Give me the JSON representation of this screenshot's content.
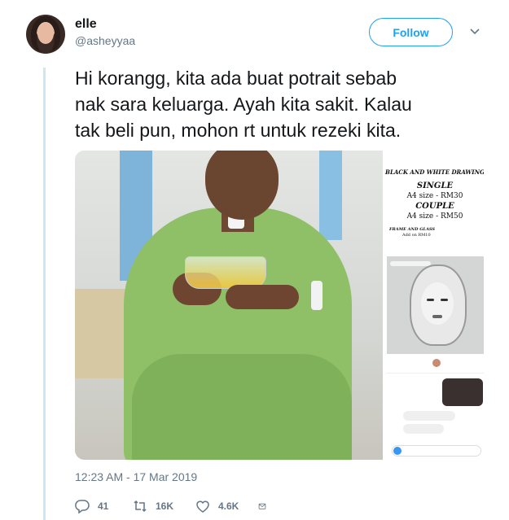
{
  "user": {
    "display_name": "elle",
    "handle": "@asheyyaa",
    "follow_label": "Follow"
  },
  "tweet": {
    "text": "Hi korangg, kita ada buat potrait sebab\nnak sara keluarga. Ayah kita sakit. Kalau\ntak beli pun, mohon rt untuk rezeki kita.",
    "timestamp": "12:23 AM - 17 Mar 2019"
  },
  "media": {
    "price_card": {
      "heading": "BLACK AND WHITE DRAWING",
      "single_label": "SINGLE",
      "single_price": "A4 size - RM30",
      "couple_label": "COUPLE",
      "couple_price": "A4 size - RM50",
      "frame_label": "FRAME AND GLASS",
      "frame_price": "Add on RM10"
    }
  },
  "actions": {
    "replies": "41",
    "retweets": "16K",
    "likes": "4.6K"
  },
  "colors": {
    "accent": "#1da1f2",
    "muted": "#657786",
    "thread_line": "#cce6f6"
  },
  "icons": [
    "chevron-down-icon",
    "reply-icon",
    "retweet-icon",
    "like-icon",
    "direct-message-icon"
  ]
}
